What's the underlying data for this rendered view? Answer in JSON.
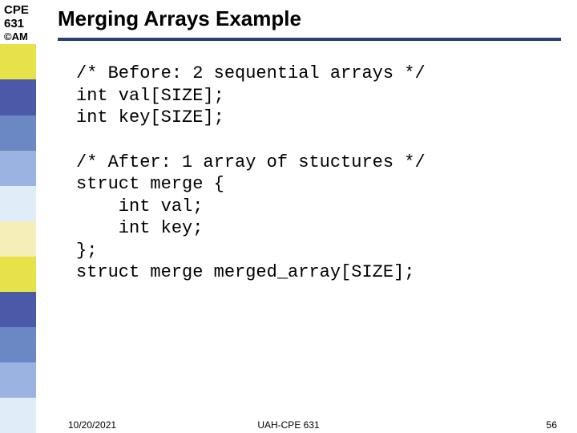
{
  "course": {
    "code_line1": "CPE",
    "code_line2": "631",
    "copyright": "©AM"
  },
  "title": "Merging Arrays Example",
  "code": {
    "before": "/* Before: 2 sequential arrays */\nint val[SIZE];\nint key[SIZE];",
    "after": "/* After: 1 array of stuctures */\nstruct merge {\n    int val;\n    int key;\n};\nstruct merge merged_array[SIZE];"
  },
  "footer": {
    "date": "10/20/2021",
    "center": "UAH-CPE 631",
    "page": "56"
  }
}
